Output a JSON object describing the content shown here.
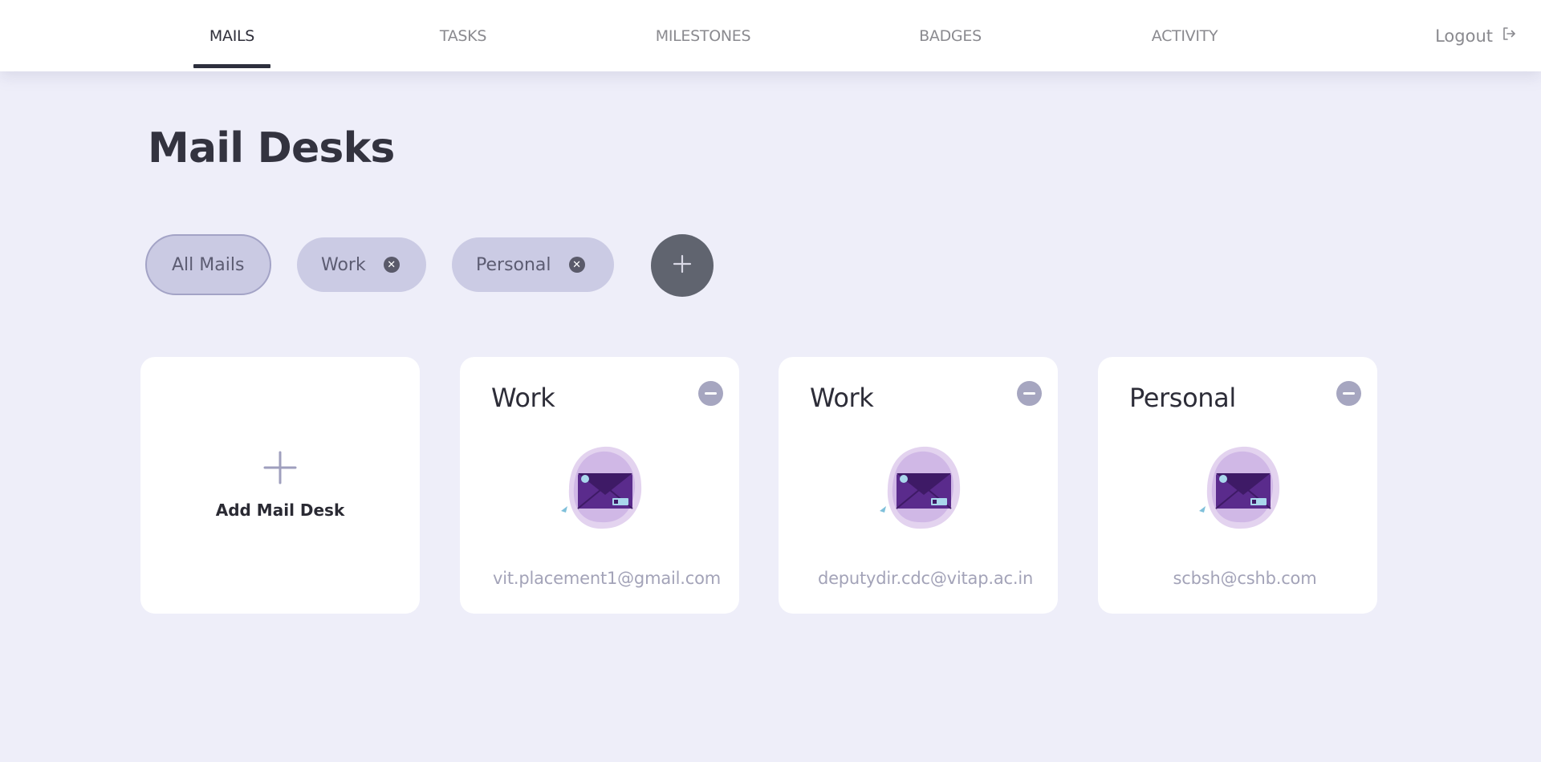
{
  "nav": {
    "tabs": [
      {
        "label": "MAILS",
        "active": true
      },
      {
        "label": "TASKS",
        "active": false
      },
      {
        "label": "MILESTONES",
        "active": false
      },
      {
        "label": "BADGES",
        "active": false
      },
      {
        "label": "ACTIVITY",
        "active": false
      }
    ],
    "logout_label": "Logout",
    "logout_icon": "logout-icon"
  },
  "page": {
    "title": "Mail Desks"
  },
  "filters": {
    "chips": [
      {
        "label": "All Mails",
        "active": true,
        "removable": false
      },
      {
        "label": "Work",
        "active": false,
        "removable": true
      },
      {
        "label": "Personal",
        "active": false,
        "removable": true
      }
    ],
    "add_icon": "plus-icon"
  },
  "cards": {
    "add_card": {
      "label": "Add Mail Desk",
      "icon": "plus-icon"
    },
    "desks": [
      {
        "title": "Work",
        "email": "vit.placement1@gmail.com",
        "icon": "mail-envelope-illustration"
      },
      {
        "title": "Work",
        "email": "deputydir.cdc@vitap.ac.in",
        "icon": "mail-envelope-illustration"
      },
      {
        "title": "Personal",
        "email": "scbsh@cshb.com",
        "icon": "mail-envelope-illustration"
      }
    ]
  },
  "colors": {
    "background": "#eeeef9",
    "chip": "#cbcbe4",
    "add_filter": "#60646f",
    "active_tab_underline": "#2d2f3d",
    "illustration_purple": "#5a2b8c"
  }
}
